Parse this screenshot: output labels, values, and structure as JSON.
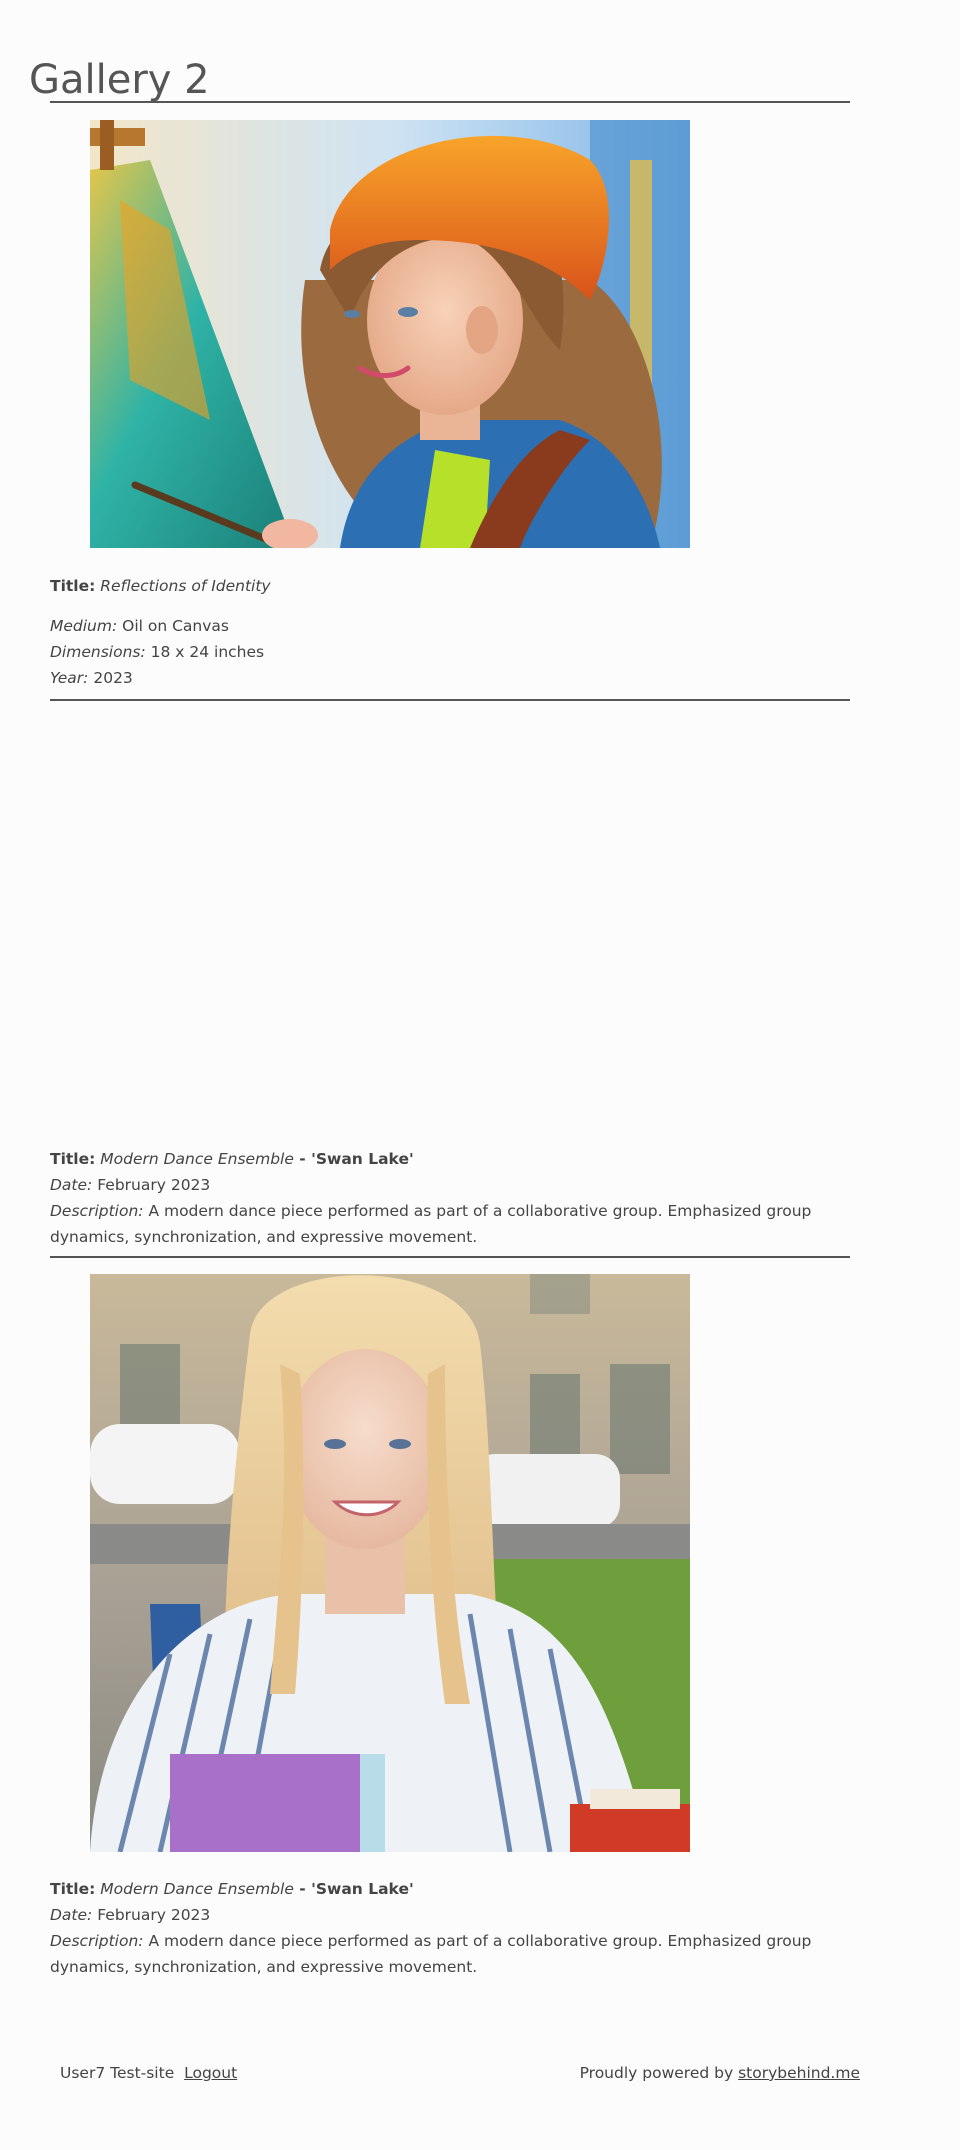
{
  "page": {
    "title": "Gallery 2"
  },
  "items": [
    {
      "title_label": "Title:",
      "title": "Reflections of Identity",
      "image_description": "painting of a girl in orange beanie painting at easel",
      "fields": [
        {
          "label": "Medium:",
          "value": "Oil on Canvas"
        },
        {
          "label": "Dimensions:",
          "value": "18 x 24 inches"
        },
        {
          "label": "Year:",
          "value": "2023"
        }
      ]
    },
    {
      "title_label": "Title:",
      "title_italic": "Modern Dance Ensemble",
      "title_bold": " - 'Swan Lake'",
      "date_label": "Date:",
      "date": "February 2023",
      "desc_label": "Description:",
      "desc": "A modern dance piece performed as part of a collaborative group. Emphasized group dynamics, synchronization, and expressive movement."
    },
    {
      "title_label": "Title:",
      "title_italic": "Modern Dance Ensemble",
      "title_bold": " - 'Swan Lake'",
      "date_label": "Date:",
      "date": "February 2023",
      "desc_label": "Description:",
      "desc": "A modern dance piece performed as part of a collaborative group. Emphasized group dynamics, synchronization, and expressive movement."
    }
  ],
  "footer": {
    "site": "User7 Test-site",
    "logout": "Logout",
    "powered_prefix": "Proudly powered by",
    "powered_link": "storybehind.me"
  }
}
